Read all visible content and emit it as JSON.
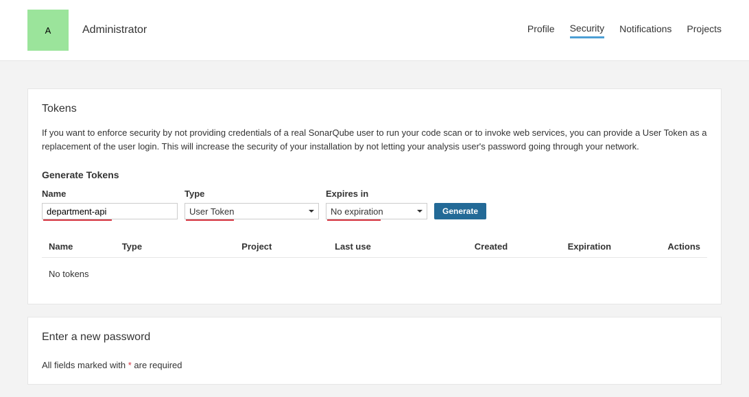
{
  "header": {
    "avatar_initial": "A",
    "user_name": "Administrator",
    "nav": {
      "profile": "Profile",
      "security": "Security",
      "notifications": "Notifications",
      "projects": "Projects"
    }
  },
  "tokens_card": {
    "title": "Tokens",
    "description": "If you want to enforce security by not providing credentials of a real SonarQube user to run your code scan or to invoke web services, you can provide a User Token as a replacement of the user login. This will increase the security of your installation by not letting your analysis user's password going through your network.",
    "generate_title": "Generate Tokens",
    "form": {
      "name_label": "Name",
      "name_value": "department-api",
      "type_label": "Type",
      "type_value": "User Token",
      "expires_label": "Expires in",
      "expires_value": "No expiration",
      "generate_button": "Generate"
    },
    "table": {
      "headers": {
        "name": "Name",
        "type": "Type",
        "project": "Project",
        "last_use": "Last use",
        "created": "Created",
        "expiration": "Expiration",
        "actions": "Actions"
      },
      "empty_message": "No tokens"
    }
  },
  "password_card": {
    "title": "Enter a new password",
    "required_prefix": "All fields marked with ",
    "required_asterisk": "*",
    "required_suffix": " are required"
  }
}
